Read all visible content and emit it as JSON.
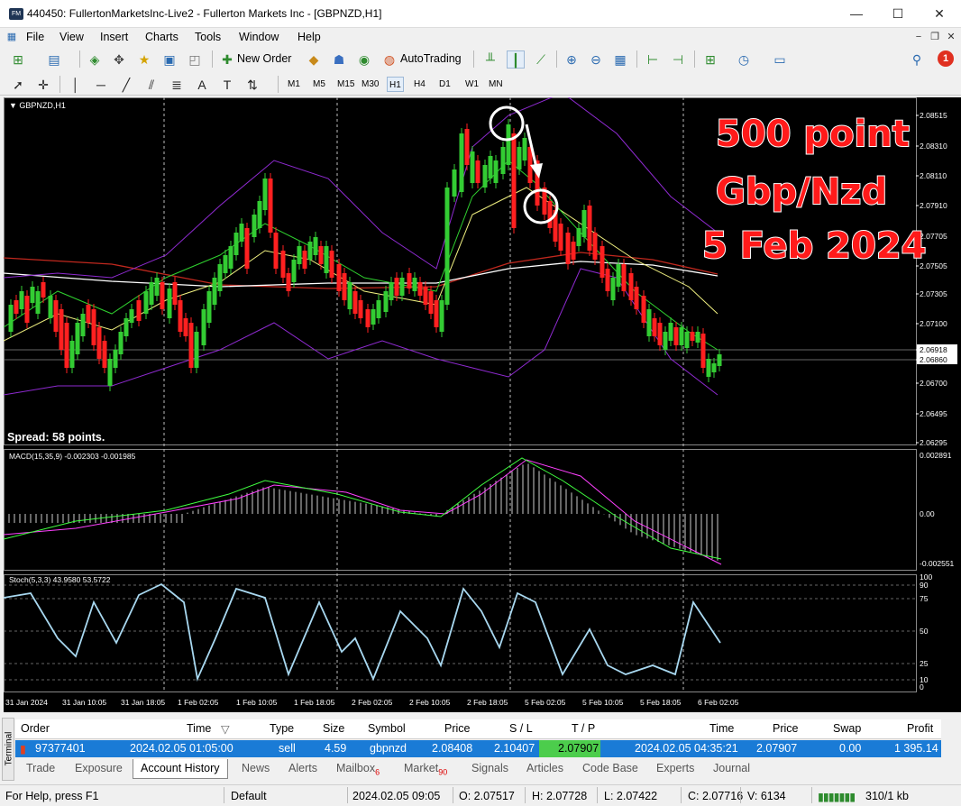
{
  "window": {
    "title": "440450: FullertonMarketsInc-Live2 - Fullerton Markets Inc - [GBPNZD,H1]",
    "app_icon": "FM"
  },
  "menu": [
    "File",
    "View",
    "Insert",
    "Charts",
    "Tools",
    "Window",
    "Help"
  ],
  "toolbar": {
    "new_order": "New Order",
    "autotrading": "AutoTrading",
    "notification_count": "1",
    "timeframes": [
      "M1",
      "M5",
      "M15",
      "M30",
      "H1",
      "H4",
      "D1",
      "W1",
      "MN"
    ],
    "active_timeframe": "H1"
  },
  "chart": {
    "symbol_label": "GBPNZD,H1",
    "spread": "Spread: 58 points.",
    "macd_label": "MACD(15,35,9) -0.002303 -0.001985",
    "stoch_label": "Stoch(5,3,3) 43.9580 53.5722",
    "price_ticks": [
      "2.08515",
      "2.08310",
      "2.08110",
      "2.07910",
      "2.07705",
      "2.07505",
      "2.07305",
      "2.07100",
      "2.06918",
      "2.06860",
      "2.06700",
      "2.06495",
      "2.06295"
    ],
    "macd_ticks": [
      "0.002891",
      "0.00",
      "-0.002551"
    ],
    "stoch_ticks": [
      "100",
      "90",
      "75",
      "50",
      "25",
      "10",
      "0"
    ],
    "time_ticks": [
      "31 Jan 2024",
      "31 Jan 10:05",
      "31 Jan 18:05",
      "1 Feb 02:05",
      "1 Feb 10:05",
      "1 Feb 18:05",
      "2 Feb 02:05",
      "2 Feb 10:05",
      "2 Feb 18:05",
      "5 Feb 02:05",
      "5 Feb 10:05",
      "5 Feb 18:05",
      "6 Feb 02:05"
    ],
    "overlay": [
      "500 point",
      "Gbp/Nzd",
      "5 Feb 2024"
    ],
    "colors": {
      "bull": "#33cc33",
      "bear": "#ff2020",
      "bands": "#8e2ad0",
      "ma_yellow": "#f0f080",
      "ma_red": "#c0281e",
      "ma_white": "#ffffff",
      "macd_signal": "#ff40ff",
      "macd_line": "#40ff40",
      "stoch": "#a8d8f0"
    }
  },
  "terminal": {
    "side_label": "Terminal",
    "headers": [
      "Order",
      "Time",
      "Type",
      "Size",
      "Symbol",
      "Price",
      "S / L",
      "T / P",
      "Time",
      "Price",
      "Swap",
      "Profit"
    ],
    "row": {
      "order": "97377401",
      "open_time": "2024.02.05 01:05:00",
      "type": "sell",
      "size": "4.59",
      "symbol": "gbpnzd",
      "open_price": "2.08408",
      "sl": "2.10407",
      "tp": "2.07907",
      "close_time": "2024.02.05 04:35:21",
      "close_price": "2.07907",
      "swap": "0.00",
      "profit": "1 395.14"
    },
    "tabs": [
      "Trade",
      "Exposure",
      "Account History",
      "News",
      "Alerts",
      "Mailbox",
      "Market",
      "Signals",
      "Articles",
      "Code Base",
      "Experts",
      "Journal"
    ],
    "mailbox_count": "6",
    "market_count": "90",
    "active_tab": "Account History"
  },
  "status": {
    "help": "For Help, press F1",
    "profile": "Default",
    "datetime": "2024.02.05 09:05",
    "open": "O: 2.07517",
    "high": "H: 2.07728",
    "low": "L: 2.07422",
    "close": "C: 2.07716",
    "volume": "V: 6134",
    "traffic": "310/1 kb"
  }
}
